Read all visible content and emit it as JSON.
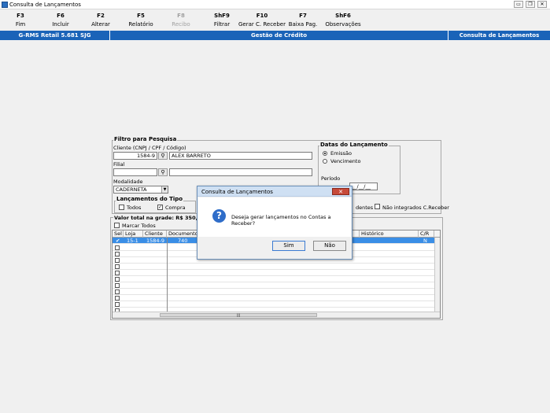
{
  "window": {
    "title": "Consulta de Lançamentos",
    "controls": [
      "▭",
      "❐",
      "✕"
    ]
  },
  "toolbar": [
    {
      "key": "F3",
      "label": "Fim",
      "enabled": true
    },
    {
      "key": "F6",
      "label": "Incluir",
      "enabled": true
    },
    {
      "key": "F2",
      "label": "Alterar",
      "enabled": true
    },
    {
      "key": "F5",
      "label": "Relatório",
      "enabled": true
    },
    {
      "key": "F8",
      "label": "Recibo",
      "enabled": false
    },
    {
      "key": "ShF9",
      "label": "Filtrar",
      "enabled": true
    },
    {
      "key": "F10",
      "label": "Gerar C. Receber",
      "enabled": true
    },
    {
      "key": "F7",
      "label": "Baixa Pag.",
      "enabled": true
    },
    {
      "key": "ShF6",
      "label": "Observações",
      "enabled": true
    }
  ],
  "bluebar": {
    "version": "G-RMS Retail 5.681 SJG",
    "module": "Gestão de Crédito",
    "screen": "Consulta de Lançamentos"
  },
  "filter": {
    "title": "Filtro para Pesquisa",
    "cliente_label": "Cliente (CNPJ / CPF / Código)",
    "cliente_code": "1584-9",
    "cliente_name": "ALEX BARRETO",
    "filial_label": "Filial",
    "filial_code": "",
    "filial_name": "",
    "modalidade_label": "Modalidade",
    "modalidade_value": "CADERNETA",
    "tipo_title": "Lançamentos do Tipo",
    "tipo_todos": "Todos",
    "tipo_compra": "Compra",
    "datas_title": "Datas do Lançamento",
    "datas_emissao": "Emissão",
    "datas_vencimento": "Vencimento",
    "periodo_label": "Período",
    "periodo_end": "__/__/__",
    "pendentes_partial": "dentes",
    "nao_integrados": "Não integrados C.Receber"
  },
  "grid": {
    "total_label": "Valor total na grade:",
    "total_value": "R$ 350,00",
    "marcar_todos": "Marcar Todos",
    "headers": [
      "Sel",
      "Loja",
      "Cliente",
      "Documento",
      "Histórico",
      "C/R"
    ],
    "rows": [
      {
        "sel": "✔",
        "loja": "15-1",
        "cliente": "1584-9",
        "documento": "740",
        "historico": "",
        "cr": "N"
      }
    ],
    "empty_rows": 11,
    "hscroll_thumb": "|||"
  },
  "dialog": {
    "title": "Consulta de Lançamentos",
    "close": "✕",
    "icon": "?",
    "message": "Deseja gerar lançamentos no Contas a Receber?",
    "yes": "Sim",
    "no": "Não"
  }
}
